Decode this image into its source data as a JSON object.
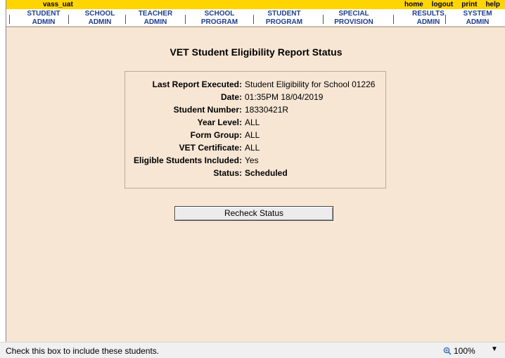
{
  "topbar": {
    "user": "vass_uat",
    "links": [
      "home",
      "logout",
      "print",
      "help"
    ]
  },
  "nav": [
    {
      "line1": "STUDENT",
      "line2": "ADMIN"
    },
    {
      "line1": "SCHOOL",
      "line2": "ADMIN"
    },
    {
      "line1": "TEACHER",
      "line2": "ADMIN"
    },
    {
      "line1": "SCHOOL",
      "line2": "PROGRAM"
    },
    {
      "line1": "STUDENT",
      "line2": "PROGRAM"
    },
    {
      "line1": "SPECIAL",
      "line2": "PROVISION"
    },
    {
      "line1": "RESULTS",
      "line2": "ADMIN"
    },
    {
      "line1": "SYSTEM",
      "line2": "ADMIN"
    }
  ],
  "page": {
    "title": "VET Student Eligibility Report Status"
  },
  "report": [
    {
      "label": "Last Report Executed:",
      "value": "Student Eligibility for School 01226"
    },
    {
      "label": "Date:",
      "value": "01:35PM 18/04/2019"
    },
    {
      "label": "Student Number:",
      "value": "18330421R"
    },
    {
      "label": "Year Level:",
      "value": "ALL"
    },
    {
      "label": "Form Group:",
      "value": "ALL"
    },
    {
      "label": "VET Certificate:",
      "value": "ALL"
    },
    {
      "label": "Eligible Students Included:",
      "value": "Yes"
    },
    {
      "label": "Status:",
      "value": "Scheduled"
    }
  ],
  "buttons": {
    "recheck": "Recheck Status"
  },
  "statusbar": {
    "message": "Check this box to include these students.",
    "zoom": "100%"
  },
  "colors": {
    "topbar": "#ffd500",
    "nav_text": "#1f3d8f",
    "background": "#f7e6d4"
  }
}
